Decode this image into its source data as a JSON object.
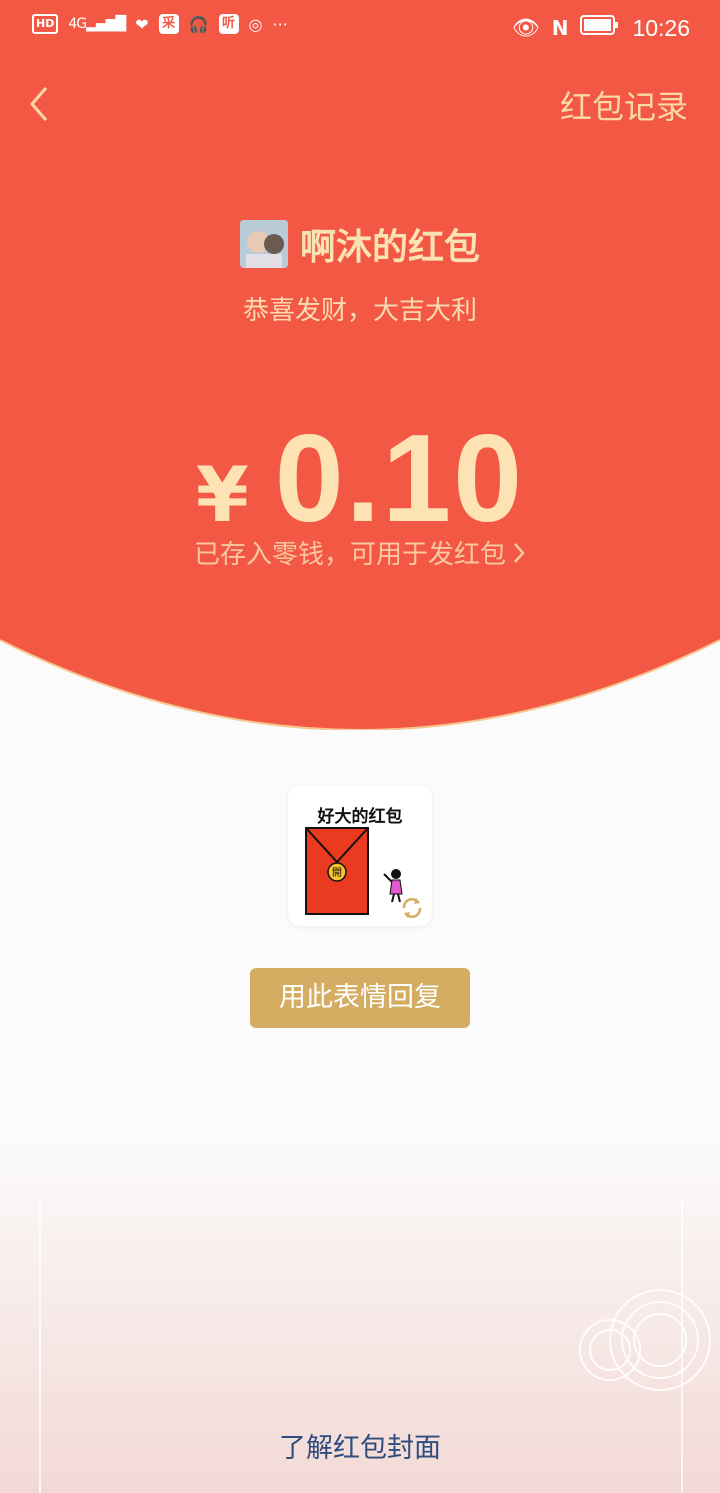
{
  "status_bar": {
    "network_badge": "HD",
    "network_type": "4G",
    "app_icons": [
      "采",
      "听"
    ],
    "time": "10:26",
    "more": "···"
  },
  "header": {
    "back_icon": "chevron-left-icon",
    "records_label": "红包记录"
  },
  "envelope": {
    "sender_name": "啊沐的红包",
    "blessing": "恭喜发财，大吉大利",
    "currency_symbol": "¥",
    "amount": "0.10",
    "stored_note": "已存入零钱，可用于发红包"
  },
  "sticker": {
    "caption": "好大的红包",
    "seal_char": "開"
  },
  "actions": {
    "reply_label": "用此表情回复"
  },
  "footer": {
    "learn_cover_label": "了解红包封面"
  },
  "colors": {
    "banner_red": "#f35844",
    "gold_text": "#fde3b4",
    "button_gold": "#d4ad62",
    "link_blue": "#2e4d7e"
  }
}
